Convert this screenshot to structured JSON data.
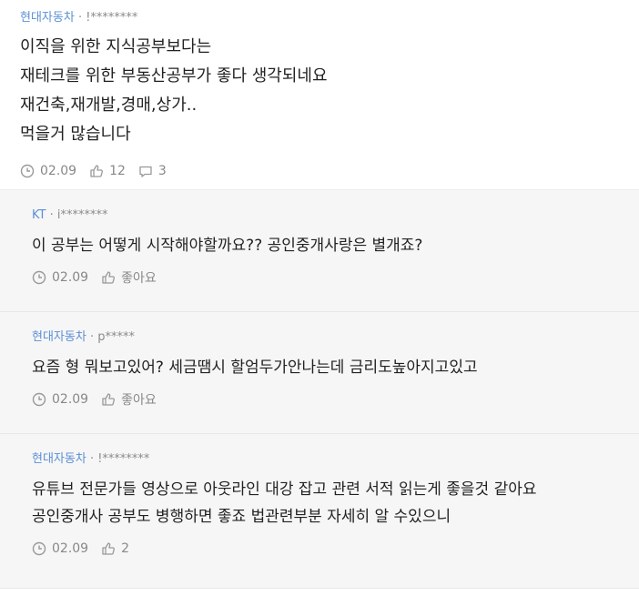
{
  "main_post": {
    "company": "현대자동차",
    "separator": " · ",
    "user": "!********",
    "lines": [
      "이직을 위한 지식공부보다는",
      "재테크를 위한 부동산공부가 좋다 생각되네요",
      "재건축,재개발,경매,상가..",
      "먹을거 많습니다"
    ],
    "date": "02.09",
    "likes": "12",
    "comments": "3"
  },
  "replies": [
    {
      "company": "KT",
      "user": "i********",
      "lines": [
        "이 공부는 어떻게 시작해야할까요?? 공인중개사랑은 별개죠?"
      ],
      "date": "02.09",
      "like_label": "좋아요"
    },
    {
      "company": "현대자동차",
      "user": "p*****",
      "lines": [
        "요즘 형 뭐보고있어? 세금땜시 할엄두가안나는데 금리도높아지고있고"
      ],
      "date": "02.09",
      "like_label": "좋아요"
    },
    {
      "company": "현대자동차",
      "user": "!********",
      "lines": [
        "유튜브 전문가들 영상으로 아웃라인 대강 잡고 관련 서적 읽는게 좋을것 같아요",
        "공인중개사 공부도 병행하면 좋죠 법관련부분 자세히 알 수있으니"
      ],
      "date": "02.09",
      "like_label": "2"
    }
  ],
  "icons": {
    "clock": "clock-icon",
    "like": "thumbs-up-icon",
    "comment": "comment-icon"
  },
  "colors": {
    "company": "#5b8fd6",
    "meta": "#8a8a8a",
    "reply_bg": "#f6f6f6"
  }
}
